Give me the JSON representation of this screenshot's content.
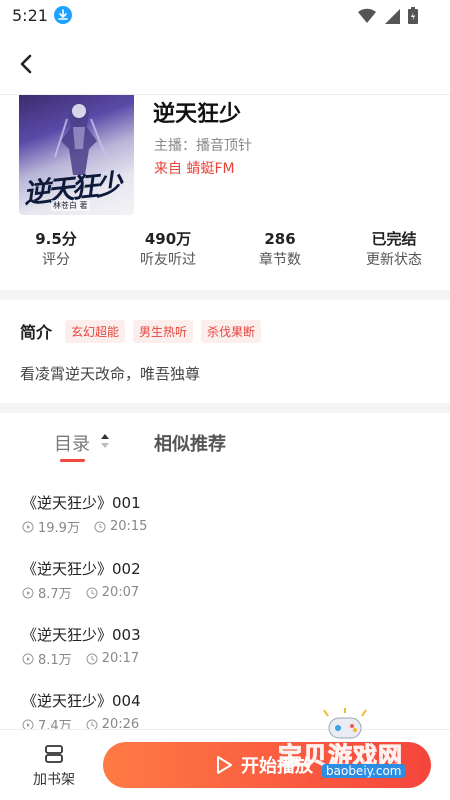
{
  "status": {
    "time": "5:21"
  },
  "book": {
    "title": "逆天狂少",
    "host": "主播：播音顶针",
    "source": "来自 蜻蜓FM",
    "cover": {
      "title_art": "逆天狂少",
      "author": "林苍白 著"
    }
  },
  "stats": [
    {
      "value": "9.5分",
      "label": "评分"
    },
    {
      "value": "490万",
      "label": "听友听过"
    },
    {
      "value": "286",
      "label": "章节数"
    },
    {
      "value": "已完结",
      "label": "更新状态"
    }
  ],
  "intro": {
    "label": "简介",
    "tags": [
      "玄幻超能",
      "男生热听",
      "杀伐果断"
    ],
    "text": "看凌霄逆天改命，唯吾独尊"
  },
  "tabs": {
    "catalog": "目录",
    "similar": "相似推荐"
  },
  "episodes": [
    {
      "title": "《逆天狂少》001",
      "plays": "19.9万",
      "duration": "20:15"
    },
    {
      "title": "《逆天狂少》002",
      "plays": "8.7万",
      "duration": "20:07"
    },
    {
      "title": "《逆天狂少》003",
      "plays": "8.1万",
      "duration": "20:17"
    },
    {
      "title": "《逆天狂少》004",
      "plays": "7.4万",
      "duration": "20:26"
    }
  ],
  "bottom": {
    "shelf": "加书架",
    "play": "开始播放"
  },
  "watermark": {
    "text": "宝贝游戏网",
    "url": "baobeiy.com"
  },
  "colors": {
    "accent": "#f0493e",
    "source": "#e8443a",
    "tag_bg": "#fdeeee",
    "play_gradient_start": "#ff7a45",
    "play_gradient_end": "#f5453c"
  }
}
